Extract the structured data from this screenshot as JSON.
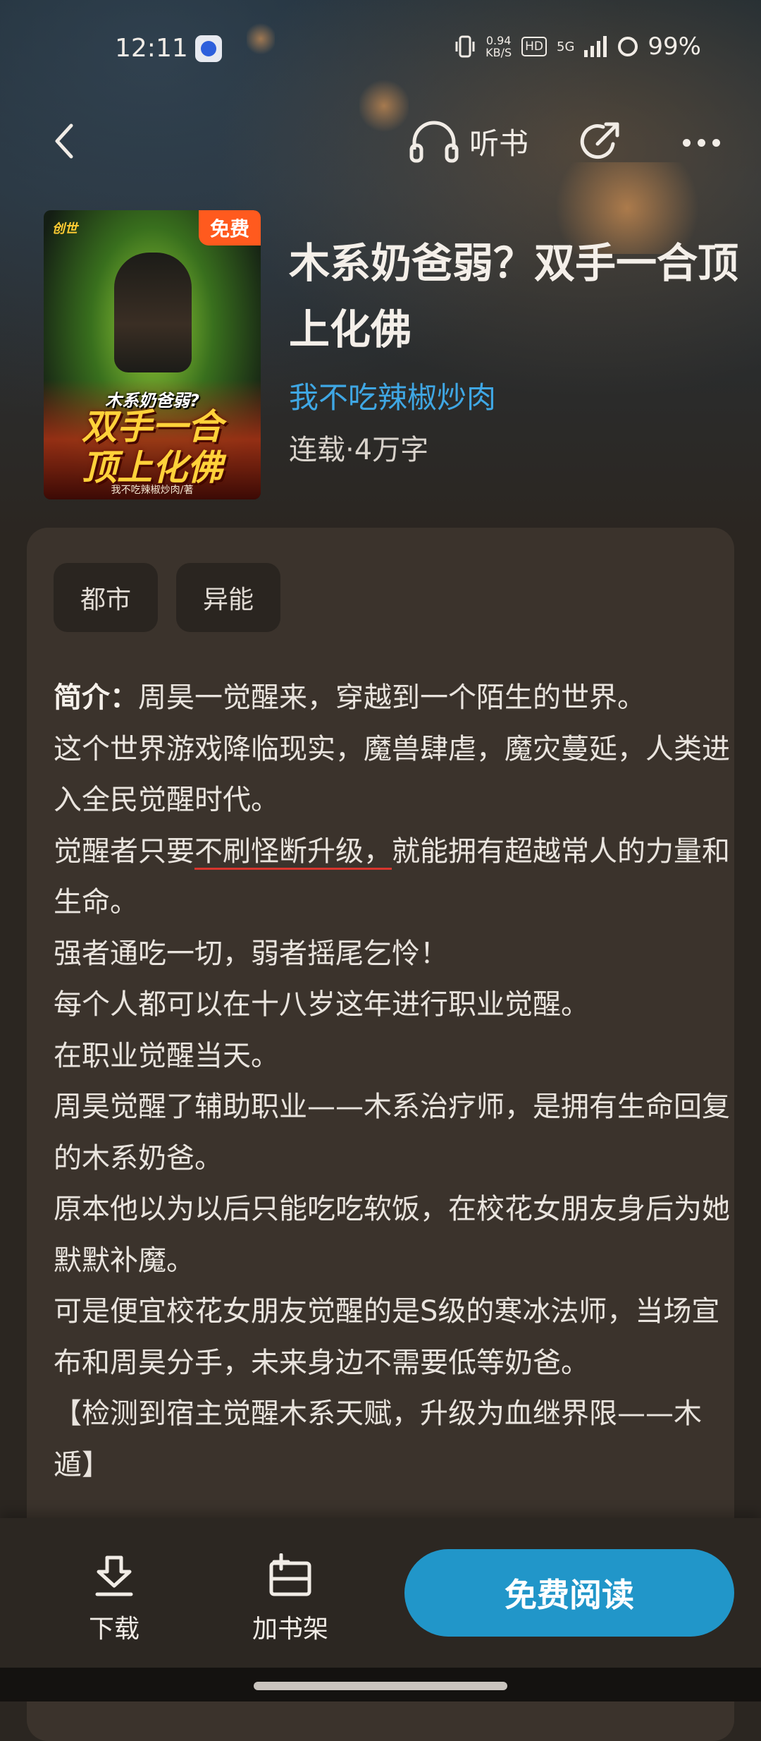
{
  "status_bar": {
    "time": "12:11",
    "net_speed_value": "0.94",
    "net_speed_unit": "KB/S",
    "hd_label": "HD",
    "network_label": "5G",
    "battery": "99%"
  },
  "nav": {
    "listen_label": "听书"
  },
  "book": {
    "cover_logo": "创世",
    "cover_subtitle": "木系奶爸弱?",
    "cover_title_line1": "双手一合",
    "cover_title_line2": "顶上化佛",
    "cover_author": "我不吃辣椒炒肉/著",
    "free_badge": "免费",
    "title": "木系奶爸弱？双手一合顶上化佛",
    "author": "我不吃辣椒炒肉",
    "meta": "连载·4万字"
  },
  "tags": [
    "都市",
    "异能"
  ],
  "intro": {
    "label": "简介：",
    "first_line": "周昊一觉醒来，穿越到一个陌生的世界。",
    "line2": "这个世界游戏降临现实，魔兽肆虐，魔灾蔓延，人类进入全民觉醒时代。",
    "line3_before": "觉醒者只要",
    "line3_underlined": "不刷怪断升级，",
    "line3_after": "就能拥有超越常人的力量和生命。",
    "line4": "强者通吃一切，弱者摇尾乞怜！",
    "line5": "每个人都可以在十八岁这年进行职业觉醒。",
    "line6": "在职业觉醒当天。",
    "line7": "周昊觉醒了辅助职业——木系治疗师，是拥有生命回复的木系奶爸。",
    "line8": "原本他以为以后只能吃吃软饭，在校花女朋友身后为她默默补魔。",
    "line9": "可是便宜校花女朋友觉醒的是S级的寒冰法师，当场宣布和周昊分手，未来身边不需要低等奶爸。",
    "line10": "【检测到宿主觉醒木系天赋，升级为血继界限——木遁】"
  },
  "bottom_bar": {
    "download_label": "下载",
    "shelf_label": "加书架",
    "read_label": "免费阅读"
  },
  "colors": {
    "accent_blue": "#2196c9",
    "author_blue": "#3fa7e4",
    "free_badge_orange": "#ff5a1e",
    "underline_red": "#d8362e"
  }
}
